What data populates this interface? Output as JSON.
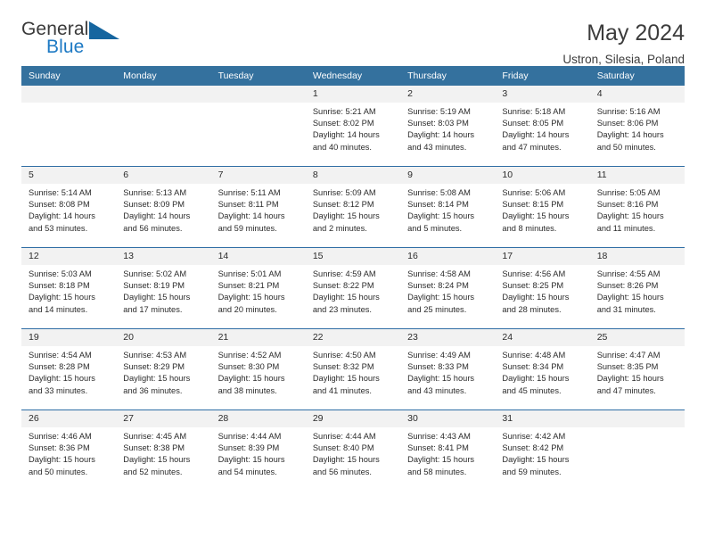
{
  "brand": {
    "name_part1": "General",
    "name_part2": "Blue",
    "triangle_icon": "triangle-icon"
  },
  "header": {
    "title": "May 2024",
    "subtitle": "Ustron, Silesia, Poland",
    "accent_color": "#34719e",
    "row_divider_color": "#2e6da4",
    "daynum_band_color": "#f2f2f2"
  },
  "weekdays": [
    "Sunday",
    "Monday",
    "Tuesday",
    "Wednesday",
    "Thursday",
    "Friday",
    "Saturday"
  ],
  "weeks": [
    [
      {
        "day": "",
        "empty": true
      },
      {
        "day": "",
        "empty": true
      },
      {
        "day": "",
        "empty": true
      },
      {
        "day": "1",
        "sunrise": "Sunrise: 5:21 AM",
        "sunset": "Sunset: 8:02 PM",
        "daylight_line1": "Daylight: 14 hours",
        "daylight_line2": "and 40 minutes."
      },
      {
        "day": "2",
        "sunrise": "Sunrise: 5:19 AM",
        "sunset": "Sunset: 8:03 PM",
        "daylight_line1": "Daylight: 14 hours",
        "daylight_line2": "and 43 minutes."
      },
      {
        "day": "3",
        "sunrise": "Sunrise: 5:18 AM",
        "sunset": "Sunset: 8:05 PM",
        "daylight_line1": "Daylight: 14 hours",
        "daylight_line2": "and 47 minutes."
      },
      {
        "day": "4",
        "sunrise": "Sunrise: 5:16 AM",
        "sunset": "Sunset: 8:06 PM",
        "daylight_line1": "Daylight: 14 hours",
        "daylight_line2": "and 50 minutes."
      }
    ],
    [
      {
        "day": "5",
        "sunrise": "Sunrise: 5:14 AM",
        "sunset": "Sunset: 8:08 PM",
        "daylight_line1": "Daylight: 14 hours",
        "daylight_line2": "and 53 minutes."
      },
      {
        "day": "6",
        "sunrise": "Sunrise: 5:13 AM",
        "sunset": "Sunset: 8:09 PM",
        "daylight_line1": "Daylight: 14 hours",
        "daylight_line2": "and 56 minutes."
      },
      {
        "day": "7",
        "sunrise": "Sunrise: 5:11 AM",
        "sunset": "Sunset: 8:11 PM",
        "daylight_line1": "Daylight: 14 hours",
        "daylight_line2": "and 59 minutes."
      },
      {
        "day": "8",
        "sunrise": "Sunrise: 5:09 AM",
        "sunset": "Sunset: 8:12 PM",
        "daylight_line1": "Daylight: 15 hours",
        "daylight_line2": "and 2 minutes."
      },
      {
        "day": "9",
        "sunrise": "Sunrise: 5:08 AM",
        "sunset": "Sunset: 8:14 PM",
        "daylight_line1": "Daylight: 15 hours",
        "daylight_line2": "and 5 minutes."
      },
      {
        "day": "10",
        "sunrise": "Sunrise: 5:06 AM",
        "sunset": "Sunset: 8:15 PM",
        "daylight_line1": "Daylight: 15 hours",
        "daylight_line2": "and 8 minutes."
      },
      {
        "day": "11",
        "sunrise": "Sunrise: 5:05 AM",
        "sunset": "Sunset: 8:16 PM",
        "daylight_line1": "Daylight: 15 hours",
        "daylight_line2": "and 11 minutes."
      }
    ],
    [
      {
        "day": "12",
        "sunrise": "Sunrise: 5:03 AM",
        "sunset": "Sunset: 8:18 PM",
        "daylight_line1": "Daylight: 15 hours",
        "daylight_line2": "and 14 minutes."
      },
      {
        "day": "13",
        "sunrise": "Sunrise: 5:02 AM",
        "sunset": "Sunset: 8:19 PM",
        "daylight_line1": "Daylight: 15 hours",
        "daylight_line2": "and 17 minutes."
      },
      {
        "day": "14",
        "sunrise": "Sunrise: 5:01 AM",
        "sunset": "Sunset: 8:21 PM",
        "daylight_line1": "Daylight: 15 hours",
        "daylight_line2": "and 20 minutes."
      },
      {
        "day": "15",
        "sunrise": "Sunrise: 4:59 AM",
        "sunset": "Sunset: 8:22 PM",
        "daylight_line1": "Daylight: 15 hours",
        "daylight_line2": "and 23 minutes."
      },
      {
        "day": "16",
        "sunrise": "Sunrise: 4:58 AM",
        "sunset": "Sunset: 8:24 PM",
        "daylight_line1": "Daylight: 15 hours",
        "daylight_line2": "and 25 minutes."
      },
      {
        "day": "17",
        "sunrise": "Sunrise: 4:56 AM",
        "sunset": "Sunset: 8:25 PM",
        "daylight_line1": "Daylight: 15 hours",
        "daylight_line2": "and 28 minutes."
      },
      {
        "day": "18",
        "sunrise": "Sunrise: 4:55 AM",
        "sunset": "Sunset: 8:26 PM",
        "daylight_line1": "Daylight: 15 hours",
        "daylight_line2": "and 31 minutes."
      }
    ],
    [
      {
        "day": "19",
        "sunrise": "Sunrise: 4:54 AM",
        "sunset": "Sunset: 8:28 PM",
        "daylight_line1": "Daylight: 15 hours",
        "daylight_line2": "and 33 minutes."
      },
      {
        "day": "20",
        "sunrise": "Sunrise: 4:53 AM",
        "sunset": "Sunset: 8:29 PM",
        "daylight_line1": "Daylight: 15 hours",
        "daylight_line2": "and 36 minutes."
      },
      {
        "day": "21",
        "sunrise": "Sunrise: 4:52 AM",
        "sunset": "Sunset: 8:30 PM",
        "daylight_line1": "Daylight: 15 hours",
        "daylight_line2": "and 38 minutes."
      },
      {
        "day": "22",
        "sunrise": "Sunrise: 4:50 AM",
        "sunset": "Sunset: 8:32 PM",
        "daylight_line1": "Daylight: 15 hours",
        "daylight_line2": "and 41 minutes."
      },
      {
        "day": "23",
        "sunrise": "Sunrise: 4:49 AM",
        "sunset": "Sunset: 8:33 PM",
        "daylight_line1": "Daylight: 15 hours",
        "daylight_line2": "and 43 minutes."
      },
      {
        "day": "24",
        "sunrise": "Sunrise: 4:48 AM",
        "sunset": "Sunset: 8:34 PM",
        "daylight_line1": "Daylight: 15 hours",
        "daylight_line2": "and 45 minutes."
      },
      {
        "day": "25",
        "sunrise": "Sunrise: 4:47 AM",
        "sunset": "Sunset: 8:35 PM",
        "daylight_line1": "Daylight: 15 hours",
        "daylight_line2": "and 47 minutes."
      }
    ],
    [
      {
        "day": "26",
        "sunrise": "Sunrise: 4:46 AM",
        "sunset": "Sunset: 8:36 PM",
        "daylight_line1": "Daylight: 15 hours",
        "daylight_line2": "and 50 minutes."
      },
      {
        "day": "27",
        "sunrise": "Sunrise: 4:45 AM",
        "sunset": "Sunset: 8:38 PM",
        "daylight_line1": "Daylight: 15 hours",
        "daylight_line2": "and 52 minutes."
      },
      {
        "day": "28",
        "sunrise": "Sunrise: 4:44 AM",
        "sunset": "Sunset: 8:39 PM",
        "daylight_line1": "Daylight: 15 hours",
        "daylight_line2": "and 54 minutes."
      },
      {
        "day": "29",
        "sunrise": "Sunrise: 4:44 AM",
        "sunset": "Sunset: 8:40 PM",
        "daylight_line1": "Daylight: 15 hours",
        "daylight_line2": "and 56 minutes."
      },
      {
        "day": "30",
        "sunrise": "Sunrise: 4:43 AM",
        "sunset": "Sunset: 8:41 PM",
        "daylight_line1": "Daylight: 15 hours",
        "daylight_line2": "and 58 minutes."
      },
      {
        "day": "31",
        "sunrise": "Sunrise: 4:42 AM",
        "sunset": "Sunset: 8:42 PM",
        "daylight_line1": "Daylight: 15 hours",
        "daylight_line2": "and 59 minutes."
      },
      {
        "day": "",
        "empty": true
      }
    ]
  ]
}
